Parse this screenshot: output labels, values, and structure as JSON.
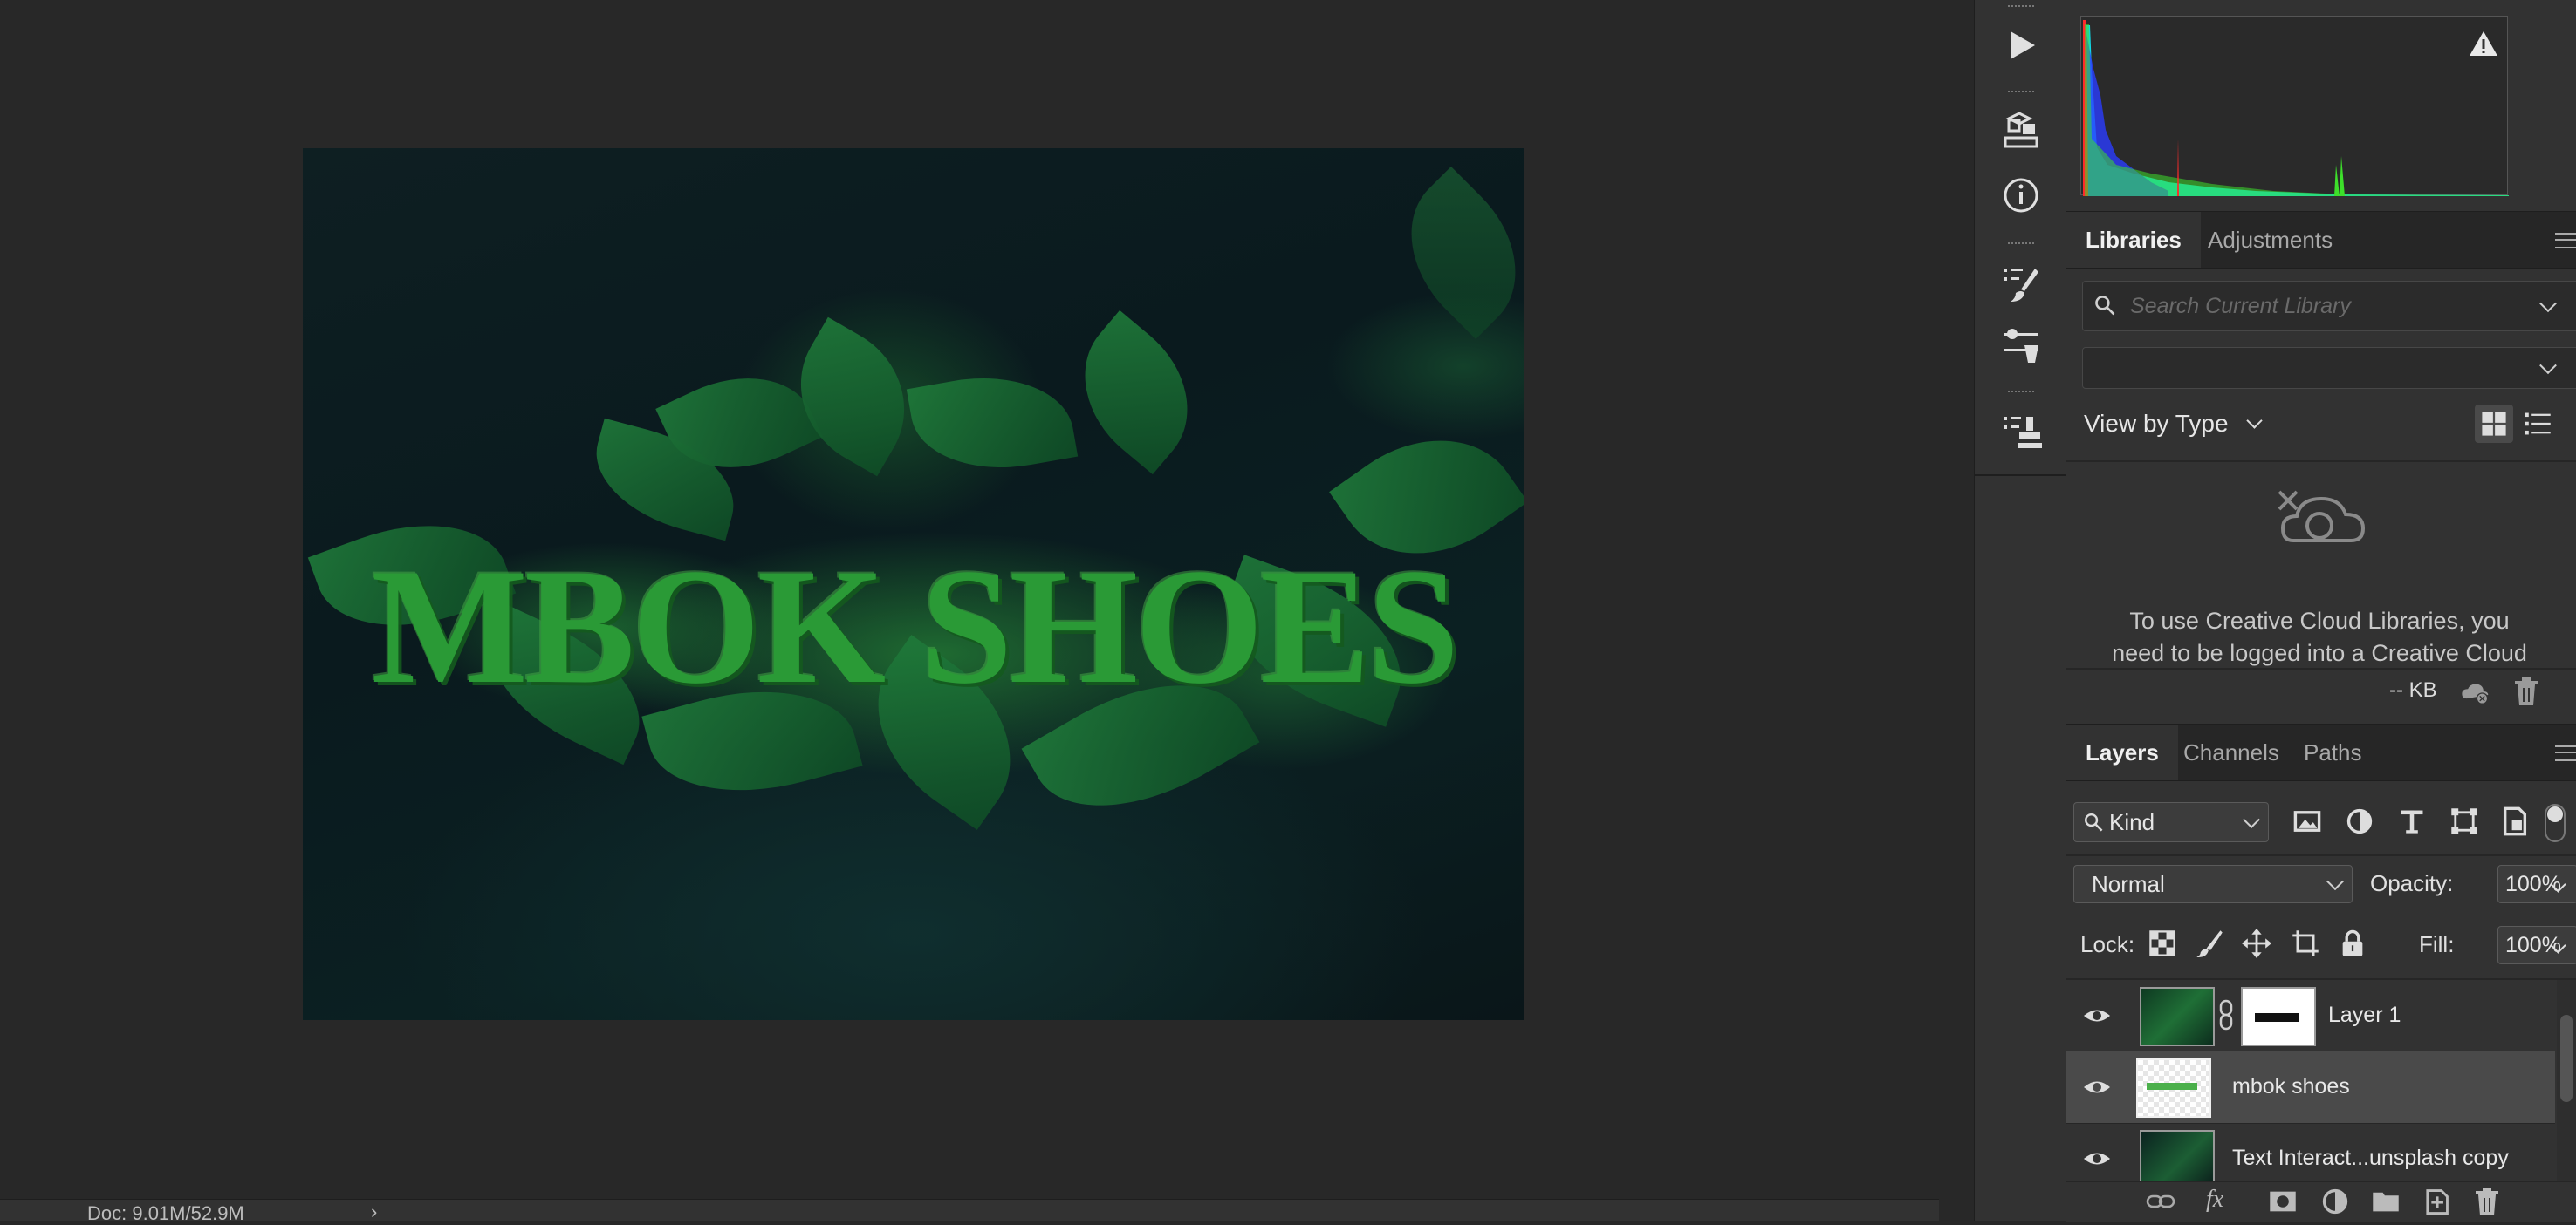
{
  "canvas": {
    "artwork_text": "MBOK SHOES"
  },
  "status": {
    "doc_info": "Doc: 9.01M/52.9M",
    "arrow": "›"
  },
  "tools": [
    "play-icon",
    "3d-cube-icon",
    "info-icon",
    "brush-presets-icon",
    "adjust-sliders-icon",
    "clone-stamp-icon"
  ],
  "histogram": {
    "warning_icon": "warning-triangle-icon"
  },
  "libraries_panel": {
    "tabs": [
      "Libraries",
      "Adjustments"
    ],
    "active_tab": "Libraries",
    "search_placeholder": "Search Current Library",
    "library_select_value": "",
    "view_by_label": "View by Type",
    "message": "To use Creative Cloud Libraries, you need to be logged into a Creative Cloud",
    "storage_label": "-- KB"
  },
  "layers_panel": {
    "tabs": [
      "Layers",
      "Channels",
      "Paths"
    ],
    "active_tab": "Layers",
    "filter_kind": "Kind",
    "blend_mode": "Normal",
    "opacity_label": "Opacity:",
    "opacity_value": "100%",
    "lock_label": "Lock:",
    "fill_label": "Fill:",
    "fill_value": "100%",
    "layers": [
      {
        "name": "Layer 1",
        "selected": false
      },
      {
        "name": "mbok shoes",
        "selected": true
      },
      {
        "name": "Text Interact...unsplash copy",
        "selected": false
      }
    ],
    "footer_fx": "fx"
  },
  "colors": {
    "canvas_bg": "#282828",
    "panel_bg": "#323232",
    "tab_bg": "#262626",
    "selected_layer": "#4a4a4a",
    "text_green": "#2a9a36"
  }
}
